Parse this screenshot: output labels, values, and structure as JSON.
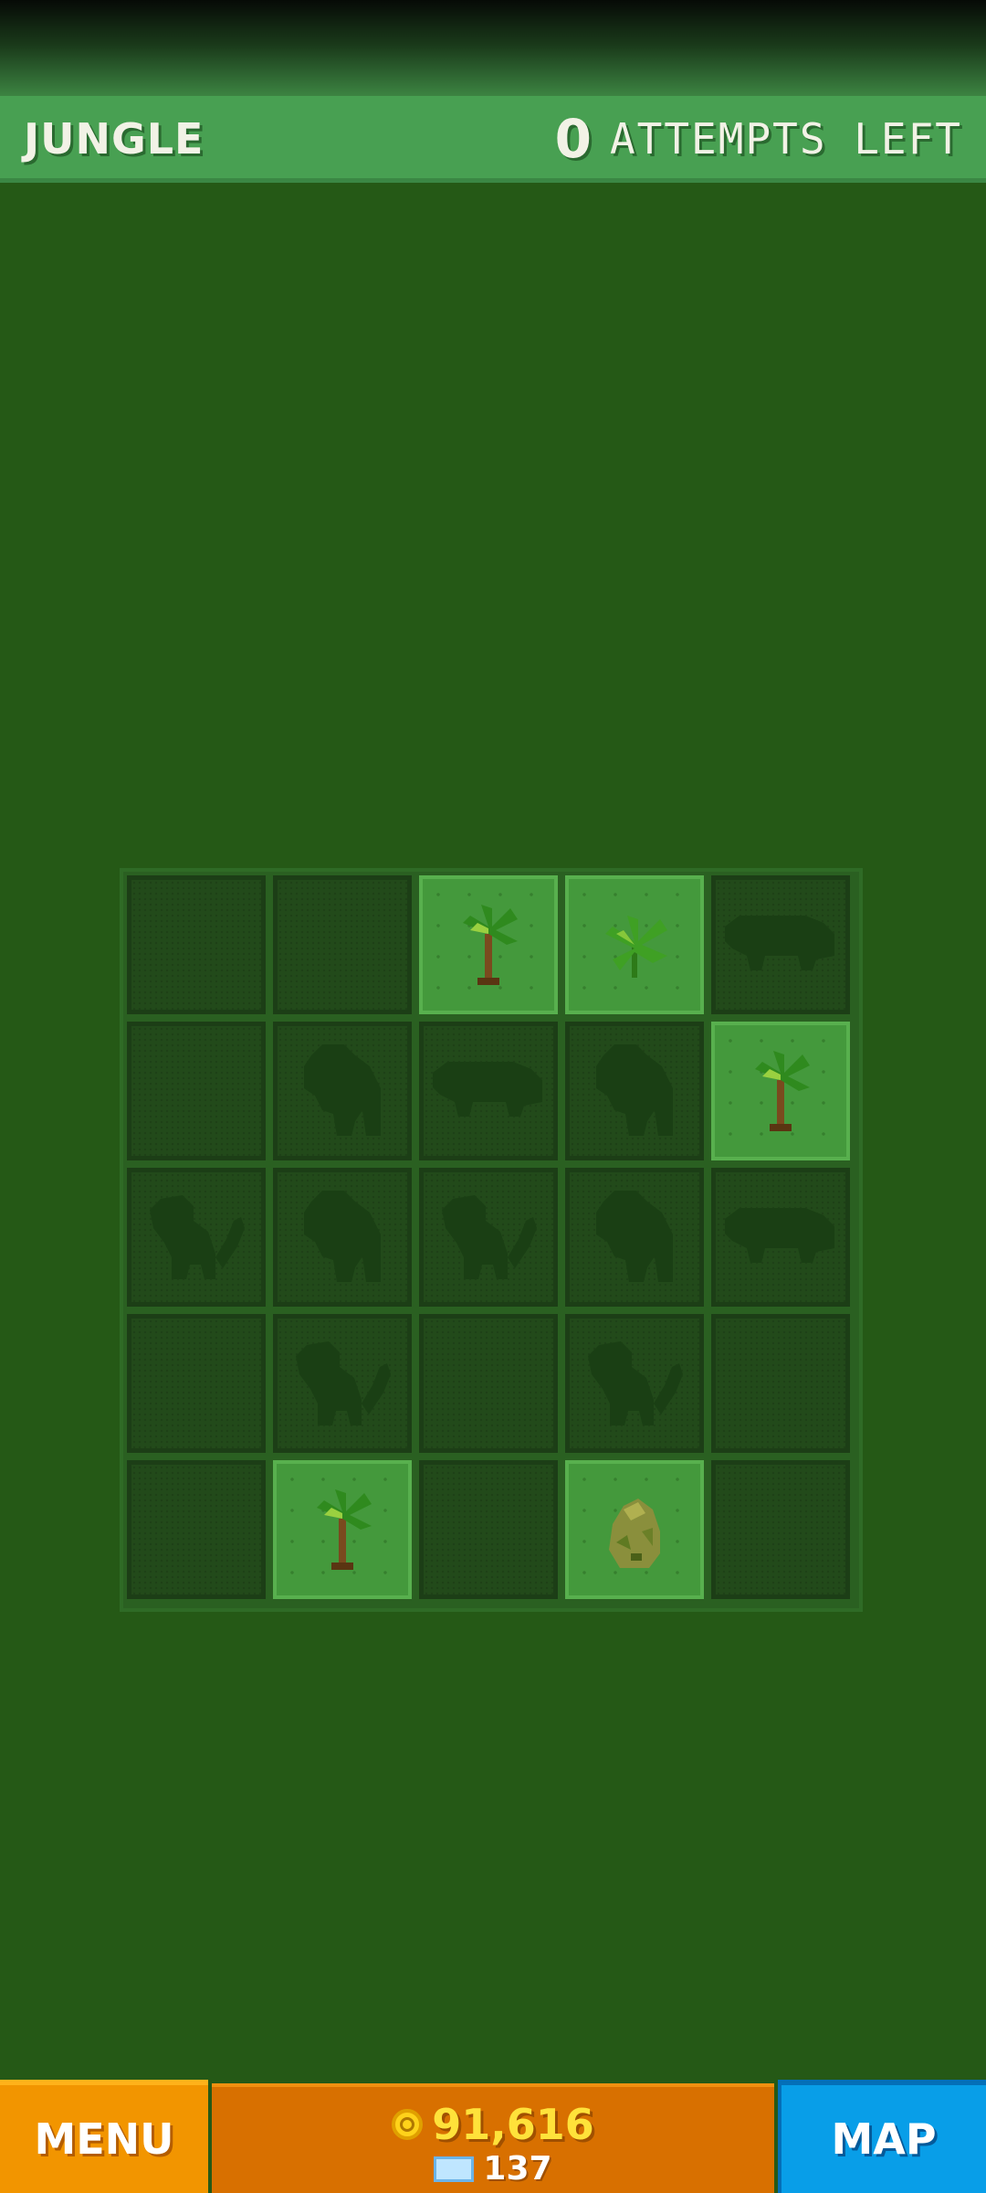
{
  "header": {
    "level_name": "JUNGLE",
    "attempts_count": "0",
    "attempts_label": "ATTEMPTS LEFT"
  },
  "board": {
    "rows": 5,
    "cols": 5,
    "tiles": [
      [
        "blank",
        "blank",
        "palm-tree",
        "fern",
        "hippo-silhouette"
      ],
      [
        "blank",
        "gorilla-silhouette",
        "hippo-silhouette",
        "gorilla-silhouette",
        "palm-tree"
      ],
      [
        "monkey-silhouette",
        "gorilla-silhouette",
        "monkey-silhouette",
        "gorilla-silhouette",
        "hippo-silhouette"
      ],
      [
        "blank",
        "monkey-silhouette",
        "blank",
        "monkey-silhouette",
        "blank"
      ],
      [
        "blank",
        "palm-tree",
        "blank",
        "mossy-rock",
        "blank"
      ]
    ],
    "revealed": [
      [
        false,
        false,
        true,
        true,
        false
      ],
      [
        false,
        false,
        false,
        false,
        true
      ],
      [
        false,
        false,
        false,
        false,
        false
      ],
      [
        false,
        false,
        false,
        false,
        false
      ],
      [
        false,
        true,
        false,
        true,
        false
      ]
    ]
  },
  "footer": {
    "menu_label": "MENU",
    "coins": "91,616",
    "gems": "137",
    "map_label": "MAP"
  },
  "colors": {
    "background": "#255916",
    "header": "#48a052",
    "menu": "#f29500",
    "map": "#089ee8",
    "coins": "#ffe23a"
  }
}
